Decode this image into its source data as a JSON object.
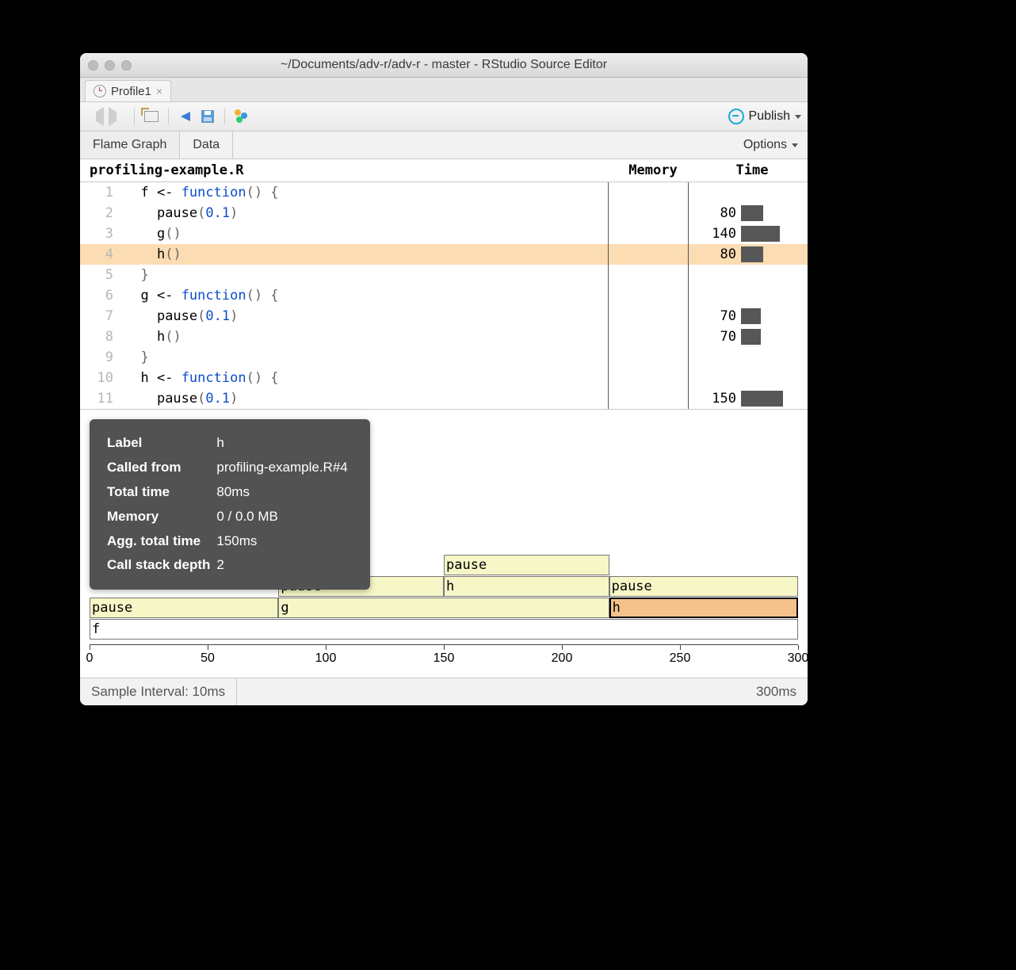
{
  "window_title": "~/Documents/adv-r/adv-r - master - RStudio Source Editor",
  "tabs": [
    {
      "label": "Profile1"
    }
  ],
  "toolbar": {
    "publish_label": "Publish"
  },
  "subtabs": {
    "flame": "Flame Graph",
    "data": "Data",
    "options": "Options"
  },
  "columns": {
    "file": "profiling-example.R",
    "memory": "Memory",
    "time": "Time"
  },
  "code": [
    {
      "n": "1",
      "indent": "  ",
      "tokens": [
        {
          "t": "f ",
          "c": ""
        },
        {
          "t": "<- ",
          "c": ""
        },
        {
          "t": "function",
          "c": "kw"
        },
        {
          "t": "() {",
          "c": "paren"
        }
      ],
      "time": null,
      "bar": 0
    },
    {
      "n": "2",
      "indent": "    ",
      "tokens": [
        {
          "t": "pause",
          "c": ""
        },
        {
          "t": "(",
          "c": "paren"
        },
        {
          "t": "0.1",
          "c": "num"
        },
        {
          "t": ")",
          "c": "paren"
        }
      ],
      "time": "80",
      "bar": 28
    },
    {
      "n": "3",
      "indent": "    ",
      "tokens": [
        {
          "t": "g",
          "c": ""
        },
        {
          "t": "()",
          "c": "paren"
        }
      ],
      "time": "140",
      "bar": 49
    },
    {
      "n": "4",
      "indent": "    ",
      "tokens": [
        {
          "t": "h",
          "c": ""
        },
        {
          "t": "()",
          "c": "paren"
        }
      ],
      "time": "80",
      "bar": 28,
      "hl": true
    },
    {
      "n": "5",
      "indent": "  ",
      "tokens": [
        {
          "t": "}",
          "c": "paren"
        }
      ],
      "time": null,
      "bar": 0
    },
    {
      "n": "6",
      "indent": "  ",
      "tokens": [
        {
          "t": "g ",
          "c": ""
        },
        {
          "t": "<- ",
          "c": ""
        },
        {
          "t": "function",
          "c": "kw"
        },
        {
          "t": "() {",
          "c": "paren"
        }
      ],
      "time": null,
      "bar": 0
    },
    {
      "n": "7",
      "indent": "    ",
      "tokens": [
        {
          "t": "pause",
          "c": ""
        },
        {
          "t": "(",
          "c": "paren"
        },
        {
          "t": "0.1",
          "c": "num"
        },
        {
          "t": ")",
          "c": "paren"
        }
      ],
      "time": "70",
      "bar": 25
    },
    {
      "n": "8",
      "indent": "    ",
      "tokens": [
        {
          "t": "h",
          "c": ""
        },
        {
          "t": "()",
          "c": "paren"
        }
      ],
      "time": "70",
      "bar": 25
    },
    {
      "n": "9",
      "indent": "  ",
      "tokens": [
        {
          "t": "}",
          "c": "paren"
        }
      ],
      "time": null,
      "bar": 0
    },
    {
      "n": "10",
      "indent": "  ",
      "tokens": [
        {
          "t": "h ",
          "c": ""
        },
        {
          "t": "<- ",
          "c": ""
        },
        {
          "t": "function",
          "c": "kw"
        },
        {
          "t": "() {",
          "c": "paren"
        }
      ],
      "time": null,
      "bar": 0
    },
    {
      "n": "11",
      "indent": "    ",
      "tokens": [
        {
          "t": "pause",
          "c": ""
        },
        {
          "t": "(",
          "c": "paren"
        },
        {
          "t": "0.1",
          "c": "num"
        },
        {
          "t": ")",
          "c": "paren"
        }
      ],
      "time": "150",
      "bar": 53
    }
  ],
  "tooltip": {
    "rows": [
      {
        "label": "Label",
        "value": "h"
      },
      {
        "label": "Called from",
        "value": "profiling-example.R#4"
      },
      {
        "label": "Total time",
        "value": "80ms"
      },
      {
        "label": "Memory",
        "value": "0 / 0.0 MB"
      },
      {
        "label": "Agg. total time",
        "value": "150ms"
      },
      {
        "label": "Call stack depth",
        "value": "2"
      }
    ]
  },
  "chart_data": {
    "type": "flame",
    "x_range": [
      0,
      300
    ],
    "ticks": [
      0,
      50,
      100,
      150,
      200,
      250,
      300
    ],
    "bars": [
      {
        "label": "f",
        "start": 0,
        "end": 300,
        "level": 0,
        "style": "base"
      },
      {
        "label": "pause",
        "start": 0,
        "end": 80,
        "level": 1,
        "style": "norm"
      },
      {
        "label": "g",
        "start": 80,
        "end": 220,
        "level": 1,
        "style": "norm"
      },
      {
        "label": "h",
        "start": 220,
        "end": 300,
        "level": 1,
        "style": "sel"
      },
      {
        "label": "pause",
        "start": 80,
        "end": 150,
        "level": 2,
        "style": "norm"
      },
      {
        "label": "h",
        "start": 150,
        "end": 220,
        "level": 2,
        "style": "norm"
      },
      {
        "label": "pause",
        "start": 220,
        "end": 300,
        "level": 2,
        "style": "norm"
      },
      {
        "label": "pause",
        "start": 150,
        "end": 220,
        "level": 3,
        "style": "norm"
      }
    ]
  },
  "status": {
    "sample": "Sample Interval: 10ms",
    "total": "300ms"
  }
}
